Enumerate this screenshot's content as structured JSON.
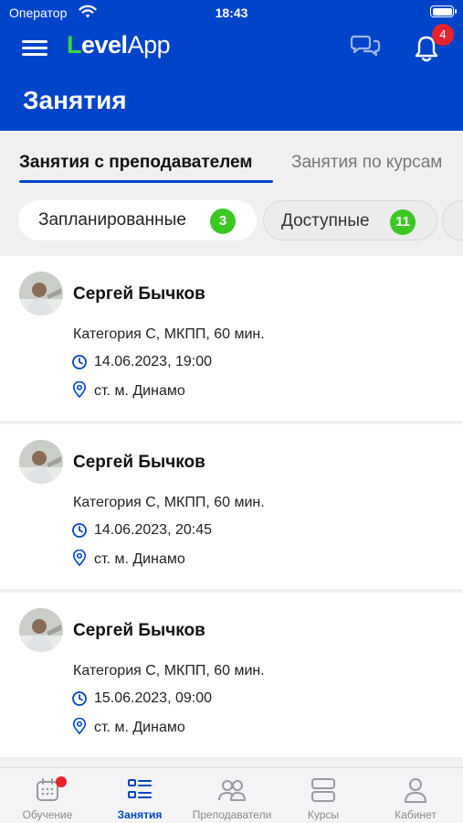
{
  "status_bar": {
    "carrier": "Оператор",
    "time": "18:43"
  },
  "header": {
    "logo_first": "L",
    "logo_rest": "evel",
    "logo_app": "App",
    "notifications_count": "4",
    "title": "Занятия"
  },
  "tabs": [
    {
      "label": "Занятия с преподавателем",
      "active": true
    },
    {
      "label": "Занятия по курсам",
      "active": false
    }
  ],
  "filters": [
    {
      "label": "Запланированные",
      "count": "3",
      "selected": true
    },
    {
      "label": "Доступные",
      "count": "11",
      "selected": false
    }
  ],
  "lessons": [
    {
      "teacher": "Сергей Бычков",
      "category": "Категория С, МКПП, 60 мин.",
      "datetime": "14.06.2023, 19:00",
      "place": "ст. м. Динамо"
    },
    {
      "teacher": "Сергей Бычков",
      "category": "Категория С, МКПП, 60 мин.",
      "datetime": "14.06.2023, 20:45",
      "place": "ст. м. Динамо"
    },
    {
      "teacher": "Сергей Бычков",
      "category": "Категория С, МКПП, 60 мин.",
      "datetime": "15.06.2023, 09:00",
      "place": "ст. м. Динамо"
    }
  ],
  "bottom_nav": [
    {
      "label": "Обучение",
      "icon": "calendar-icon",
      "active": false,
      "has_dot": true
    },
    {
      "label": "Занятия",
      "icon": "list-icon",
      "active": true,
      "has_dot": false
    },
    {
      "label": "Преподаватели",
      "icon": "people-icon",
      "active": false,
      "has_dot": false
    },
    {
      "label": "Курсы",
      "icon": "stack-icon",
      "active": false,
      "has_dot": false
    },
    {
      "label": "Кабинет",
      "icon": "person-icon",
      "active": false,
      "has_dot": false
    }
  ],
  "colors": {
    "primary": "#0044c9",
    "accent_green": "#3cc724",
    "badge_red": "#e6232c",
    "background": "#f0f0f2"
  }
}
